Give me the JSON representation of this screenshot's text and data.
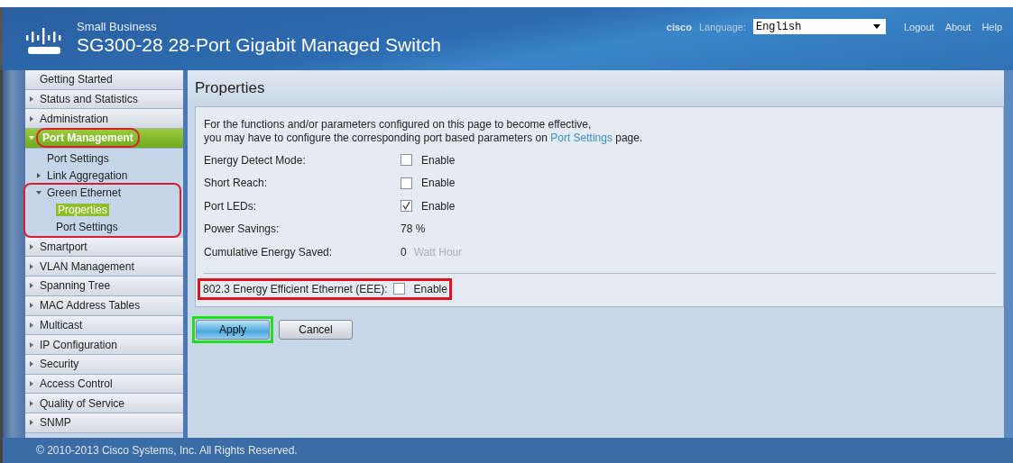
{
  "header": {
    "brand": "Small Business",
    "title": "SG300-28 28-Port Gigabit Managed Switch",
    "user": "cisco",
    "language_label": "Language:",
    "language": "English",
    "links": [
      "Logout",
      "About",
      "Help"
    ]
  },
  "sidebar": {
    "items": [
      {
        "label": "Getting Started",
        "selected": false,
        "annotated": false
      },
      {
        "label": "Status and Statistics",
        "expanded": false,
        "selected": false,
        "annotated": false
      },
      {
        "label": "Administration",
        "expanded": false,
        "selected": false,
        "annotated": false
      },
      {
        "label": "Port Management",
        "expanded": true,
        "selected": true,
        "annotated": true,
        "children": [
          {
            "label": "Port Settings",
            "selected": false,
            "annotated": false
          },
          {
            "label": "Link Aggregation",
            "expanded": false,
            "selected": false,
            "annotated": false
          },
          {
            "label": "Green Ethernet",
            "expanded": true,
            "selected": false,
            "annotated": true,
            "children": [
              {
                "label": "Properties",
                "selected": true
              },
              {
                "label": "Port Settings",
                "selected": false
              }
            ]
          }
        ]
      },
      {
        "label": "Smartport",
        "expanded": false,
        "selected": false,
        "annotated": false
      },
      {
        "label": "VLAN Management",
        "expanded": false,
        "selected": false,
        "annotated": false
      },
      {
        "label": "Spanning Tree",
        "expanded": false,
        "selected": false,
        "annotated": false
      },
      {
        "label": "MAC Address Tables",
        "expanded": false,
        "selected": false,
        "annotated": false
      },
      {
        "label": "Multicast",
        "expanded": false,
        "selected": false,
        "annotated": false
      },
      {
        "label": "IP Configuration",
        "expanded": false,
        "selected": false,
        "annotated": false
      },
      {
        "label": "Security",
        "expanded": false,
        "selected": false,
        "annotated": false
      },
      {
        "label": "Access Control",
        "expanded": false,
        "selected": false,
        "annotated": false
      },
      {
        "label": "Quality of Service",
        "expanded": false,
        "selected": false,
        "annotated": false
      },
      {
        "label": "SNMP",
        "expanded": false,
        "selected": false,
        "annotated": false
      }
    ]
  },
  "page": {
    "title": "Properties",
    "note": [
      "For the functions and/or parameters configured on this page to become effective,",
      "you may have to configure the corresponding port based parameters on",
      "Port Settings",
      "page."
    ],
    "fields": [
      {
        "kind": "checkbox",
        "label": "Energy Detect Mode:",
        "checked": false,
        "option": "Enable"
      },
      {
        "kind": "checkbox",
        "label": "Short Reach:",
        "checked": false,
        "option": "Enable"
      },
      {
        "kind": "checkbox",
        "label": "Port LEDs:",
        "checked": true,
        "option": "Enable"
      },
      {
        "kind": "value",
        "label": "Power Savings:",
        "value": "78 %"
      },
      {
        "kind": "value",
        "label": "Cumulative Energy Saved:",
        "value": "0",
        "unit": "Watt Hour"
      }
    ],
    "eee": {
      "label": "802.3 Energy Efficient Ethernet (EEE):",
      "checked": false,
      "option": "Enable",
      "annotated": true
    },
    "buttons": [
      {
        "label": "Apply",
        "kind": "primary",
        "annotated": true
      },
      {
        "label": "Cancel",
        "kind": "secondary",
        "annotated": false
      }
    ]
  },
  "footer": "© 2010-2013 Cisco Systems, Inc. All Rights Reserved."
}
